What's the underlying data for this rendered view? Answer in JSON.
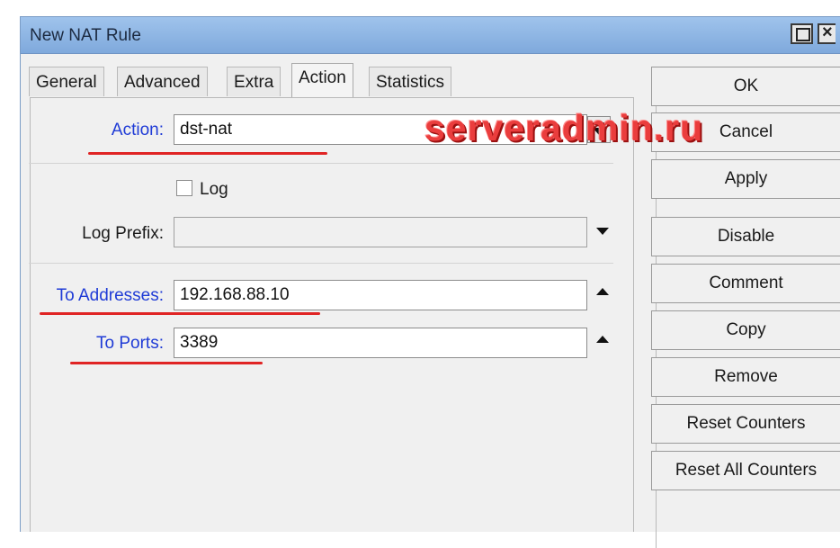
{
  "window": {
    "title": "New NAT Rule",
    "buttons": [
      "maximize-icon",
      "close-icon"
    ]
  },
  "tabs": [
    {
      "label": "General",
      "active": false
    },
    {
      "label": "Advanced",
      "active": false
    },
    {
      "label": "Extra",
      "active": false
    },
    {
      "label": "Action",
      "active": true
    },
    {
      "label": "Statistics",
      "active": false
    }
  ],
  "form": {
    "action": {
      "label": "Action:",
      "value": "dst-nat"
    },
    "log": {
      "label": "Log",
      "checked": false
    },
    "log_prefix": {
      "label": "Log Prefix:",
      "value": ""
    },
    "to_addresses": {
      "label": "To Addresses:",
      "value": "192.168.88.10"
    },
    "to_ports": {
      "label": "To Ports:",
      "value": "3389"
    }
  },
  "watermark": "serveradmin.ru",
  "side_buttons": {
    "ok": "OK",
    "cancel": "Cancel",
    "apply": "Apply",
    "disable": "Disable",
    "comment": "Comment",
    "copy": "Copy",
    "remove": "Remove",
    "reset_counters": "Reset Counters",
    "reset_all_counters": "Reset All Counters"
  },
  "colors": {
    "title_bar": "#8fb7e6",
    "label_highlight": "#1f3bd6",
    "annotation_underline": "#e02424",
    "watermark": "#ea3d3d"
  }
}
